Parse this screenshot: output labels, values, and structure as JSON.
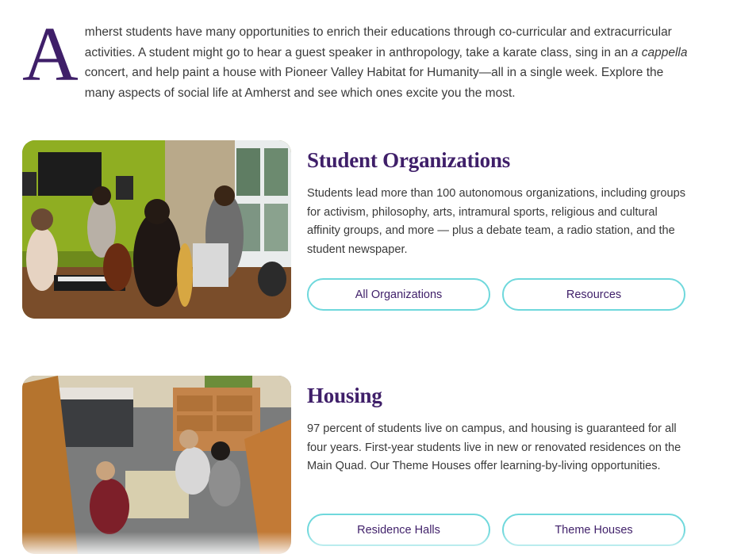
{
  "intro": {
    "drop_cap": "A",
    "text_before_italic": "mherst students have many opportunities to enrich their educations through co-curricular and extracurricular activities. A student might go to hear a guest speaker in anthropology, take a karate class, sing in an ",
    "italic": "a cappella",
    "text_after_italic": " concert, and help paint a house with Pioneer Valley Habitat for Humanity—all in a single week. Explore the many aspects of social life at Amherst and see which ones excite you the most."
  },
  "sections": [
    {
      "title": "Student Organizations",
      "description": "Students lead more than 100 autonomous organizations, including groups for activism, philosophy, arts,  intramural sports, religious and cultural affinity groups, and more — plus a debate team, a radio station, and the student newspaper.",
      "buttons": [
        "All Organizations",
        "Resources"
      ]
    },
    {
      "title": "Housing",
      "description": "97 percent of students live on campus, and housing is guaranteed for all four years. First-year students live in new or renovated residences on the Main Quad. Our Theme Houses offer learning-by-living opportunities.",
      "buttons": [
        "Residence Halls",
        "Theme Houses"
      ]
    }
  ],
  "colors": {
    "accent_purple": "#3f1f69",
    "button_border_teal": "#6fd8dc",
    "body_text": "#3a3a3a"
  }
}
